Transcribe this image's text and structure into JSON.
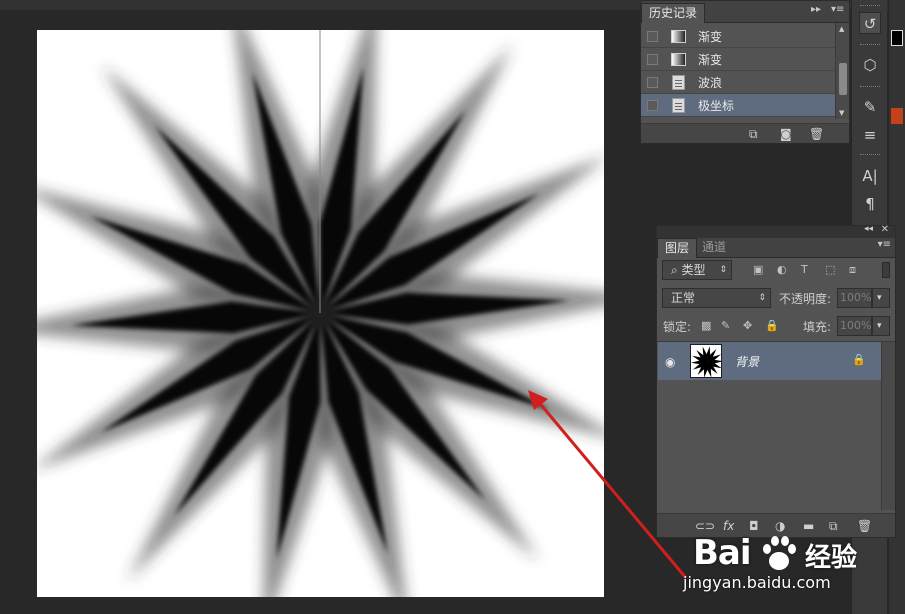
{
  "history_panel": {
    "tab_label": "历史记录",
    "items": [
      {
        "label": "渐变",
        "icon": "gradient-icon",
        "selected": false
      },
      {
        "label": "渐变",
        "icon": "gradient-icon",
        "selected": false
      },
      {
        "label": "波浪",
        "icon": "document-icon",
        "selected": false
      },
      {
        "label": "极坐标",
        "icon": "document-icon",
        "selected": true
      }
    ],
    "footer_icons": [
      "new-document-from-state-icon",
      "camera-icon",
      "trash-icon"
    ]
  },
  "layers_panel": {
    "tabs": [
      {
        "label": "图层",
        "active": true
      },
      {
        "label": "通道",
        "active": false
      }
    ],
    "filter_kind": "类型",
    "blend_mode": "正常",
    "opacity_label": "不透明度:",
    "opacity_value": "100%",
    "lock_label": "锁定:",
    "fill_label": "填充:",
    "fill_value": "100%",
    "layers": [
      {
        "name": "背景",
        "visible": true,
        "locked": true
      }
    ],
    "footer_icons": [
      "link-icon",
      "fx-icon",
      "mask-icon",
      "adjustment-icon",
      "folder-icon",
      "new-layer-icon",
      "trash-icon"
    ]
  },
  "tool_strip": {
    "icons": [
      "history-brush-icon",
      "3d-icon",
      "brush-presets-icon",
      "adjust-icon",
      "character-icon",
      "paragraph-icon"
    ],
    "glyphs": [
      "↺",
      "⬡",
      "✎",
      "≡",
      "A|",
      "¶"
    ]
  },
  "watermark": {
    "logo": "Bai",
    "logo_cn": "经验",
    "url": "jingyan.baidu.com"
  },
  "colors": {
    "selection": "#5f6c80",
    "panel": "#535353",
    "arrow": "#d11f1f"
  }
}
